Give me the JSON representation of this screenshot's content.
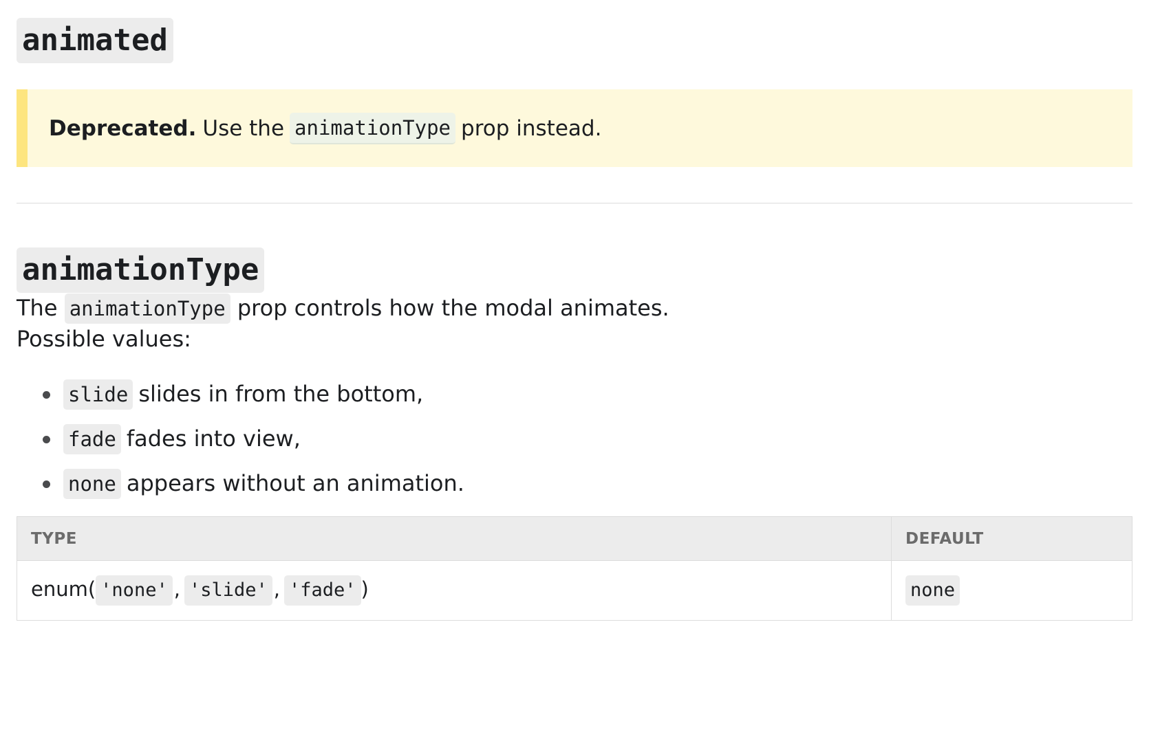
{
  "sections": {
    "animated": {
      "title": "animated",
      "deprecated": {
        "label": "Deprecated.",
        "text_before": "Use the",
        "code": "animationType",
        "text_after": "prop instead."
      }
    },
    "animationType": {
      "title": "animationType",
      "description": {
        "text_before": "The",
        "code": "animationType",
        "text_after": "prop controls how the modal animates."
      },
      "possible_values_label": "Possible values:",
      "values": [
        {
          "code": "slide",
          "text": "slides in from the bottom,"
        },
        {
          "code": "fade",
          "text": "fades into view,"
        },
        {
          "code": "none",
          "text": "appears without an animation."
        }
      ],
      "table": {
        "headers": {
          "type": "TYPE",
          "default": "DEFAULT"
        },
        "type_prefix": "enum(",
        "type_values": [
          "'none'",
          "'slide'",
          "'fade'"
        ],
        "type_separator": ",",
        "type_suffix": ")",
        "default_value": "none"
      }
    }
  },
  "colors": {
    "deprecated_background": "#fef9dc",
    "deprecated_border": "#fde57f",
    "code_background": "#ececec",
    "table_header_background": "#ececec"
  }
}
